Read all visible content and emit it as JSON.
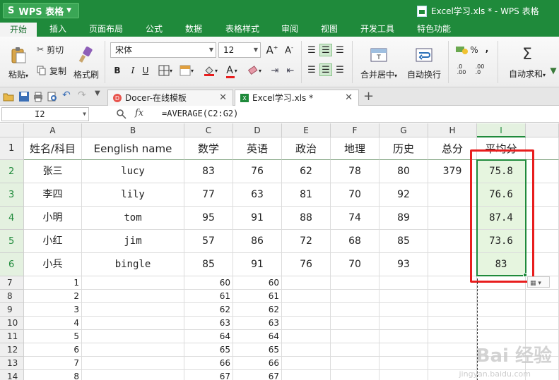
{
  "app": {
    "name": "WPS 表格",
    "logo": "S",
    "window_title": "Excel学习.xls * - WPS 表格"
  },
  "menu": [
    "开始",
    "插入",
    "页面布局",
    "公式",
    "数据",
    "表格样式",
    "审阅",
    "视图",
    "开发工具",
    "特色功能"
  ],
  "ribbon": {
    "paste": "粘贴",
    "cut": "剪切",
    "copy": "复制",
    "format_painter": "格式刷",
    "font_name": "宋体",
    "font_size": "12",
    "merge_center": "合并居中",
    "wrap_text": "自动换行",
    "autosum": "自动求和",
    "bold": "B",
    "italic": "I",
    "underline": "U",
    "percent": "%",
    "comma": ","
  },
  "doc_tabs": [
    {
      "label": "Docer-在线模板"
    },
    {
      "label": "Excel学习.xls *"
    }
  ],
  "formula_bar": {
    "name_box": "I2",
    "fx": "fx",
    "formula": "=AVERAGE(C2:G2)"
  },
  "columns": [
    "A",
    "B",
    "C",
    "D",
    "E",
    "F",
    "G",
    "H",
    "I"
  ],
  "rows": [
    "1",
    "2",
    "3",
    "4",
    "5",
    "6",
    "7",
    "8",
    "9",
    "10",
    "11",
    "12",
    "13",
    "14"
  ],
  "header_row": [
    "姓名/科目",
    "Eenglish name",
    "数学",
    "英语",
    "政治",
    "地理",
    "历史",
    "总分",
    "平均分"
  ],
  "students": [
    [
      "张三",
      "lucy",
      "83",
      "76",
      "62",
      "78",
      "80",
      "379",
      "75.8"
    ],
    [
      "李四",
      "lily",
      "77",
      "63",
      "81",
      "70",
      "92",
      "",
      "76.6"
    ],
    [
      "小明",
      "tom",
      "95",
      "91",
      "88",
      "74",
      "89",
      "",
      "87.4"
    ],
    [
      "小红",
      "jim",
      "57",
      "86",
      "72",
      "68",
      "85",
      "",
      "73.6"
    ],
    [
      "小兵",
      "bingle",
      "85",
      "91",
      "76",
      "70",
      "93",
      "",
      "83"
    ]
  ],
  "extra_rows": [
    [
      "1",
      "60",
      "60"
    ],
    [
      "2",
      "61",
      "61"
    ],
    [
      "3",
      "62",
      "62"
    ],
    [
      "4",
      "63",
      "63"
    ],
    [
      "5",
      "64",
      "64"
    ],
    [
      "6",
      "65",
      "65"
    ],
    [
      "7",
      "66",
      "66"
    ],
    [
      "8",
      "67",
      "67"
    ]
  ],
  "watermark": {
    "text": "Bai 经验",
    "url": "jingyan.baidu.com"
  },
  "colors": {
    "accent": "#1f8a3b",
    "highlight_box": "#e81e1e",
    "selection_fill": "#e6f5df"
  }
}
